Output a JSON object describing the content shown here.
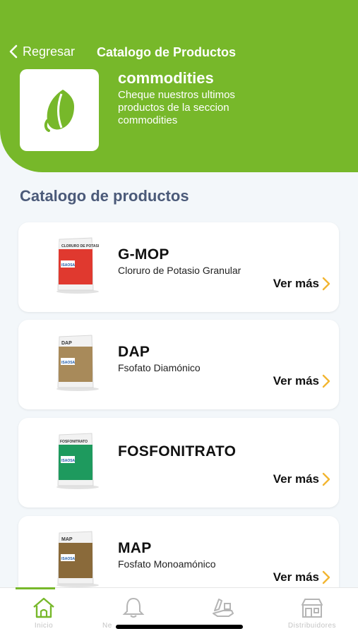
{
  "header": {
    "back_label": "Regresar",
    "nav_title": "Catalogo de Productos",
    "category_title": "commodities",
    "category_description": "Cheque nuestros ultimos productos de la seccion commodities",
    "category_icon": "leaf-icon"
  },
  "section_title": "Catalogo de productos",
  "see_more_label": "Ver más",
  "products": [
    {
      "name": "G-MOP",
      "description": "Cloruro de Potasio Granular",
      "bag_label": "CLORURO DE POTASIO",
      "bag_color": "#e0392f"
    },
    {
      "name": "DAP",
      "description": "Fsofato Diamónico",
      "bag_label": "DAP",
      "bag_color": "#a88a5a"
    },
    {
      "name": "FOSFONITRATO",
      "description": "",
      "bag_label": "FOSFONITRATO",
      "bag_color": "#1e9a5e"
    },
    {
      "name": "MAP",
      "description": "Fosfato Monoamónico",
      "bag_label": "MAP",
      "bag_color": "#8a6a3a"
    }
  ],
  "brand_on_bag": "ISAOSA",
  "tabs": [
    {
      "label": "Inicio",
      "icon": "home-icon",
      "active": true
    },
    {
      "label": "Ne",
      "icon": "bell-icon",
      "active": false
    },
    {
      "label": "",
      "icon": "shipping-icon",
      "active": false
    },
    {
      "label": "Distribuidores",
      "icon": "store-icon",
      "active": false
    }
  ],
  "colors": {
    "primary": "#77b82a",
    "chevron": "#f2b531",
    "section_title": "#4b5a79"
  }
}
